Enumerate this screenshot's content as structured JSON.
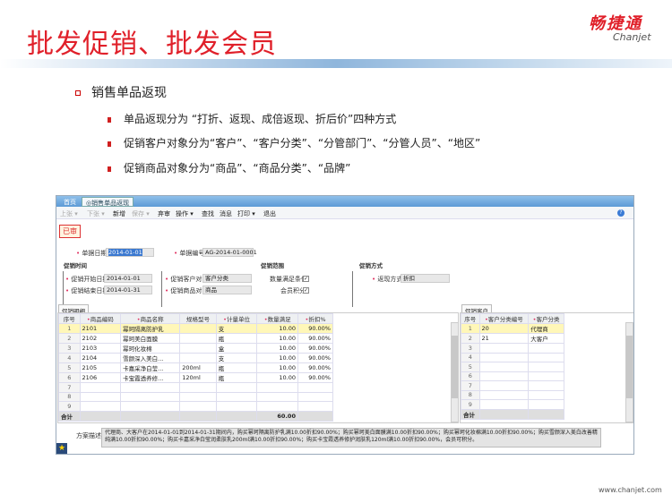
{
  "slide": {
    "title": "批发促销、批发会员",
    "logo_cn": "畅捷通",
    "logo_en": "Chanjet",
    "bullet": "销售单品返现",
    "sub_bullets": [
      "单品返现分为 “打折、返现、成倍返现、折后价”四种方式",
      "促销客户对象分为“客户”、“客户分类”、“分管部门”、“分管人员”、“地区”",
      "促销商品对象分为“商品”、“商品分类”、“品牌”"
    ],
    "footer": "www.chanjet.com",
    "accent_color": "#e0202a"
  },
  "app": {
    "tabs": [
      {
        "label": "首页"
      },
      {
        "label": "销售单品返现",
        "active": true
      }
    ],
    "toolbar": [
      {
        "label": "上张 ▾",
        "disabled": true
      },
      {
        "label": "下张 ▾",
        "disabled": true
      },
      {
        "label": "新增"
      },
      {
        "label": "保存 ▾",
        "disabled": true
      },
      {
        "label": "弃审"
      },
      {
        "label": "操作 ▾"
      },
      {
        "label": "查找"
      },
      {
        "label": "消息"
      },
      {
        "label": "打印 ▾"
      },
      {
        "label": "退出"
      }
    ],
    "help_icon": "?",
    "status": "已审",
    "header": {
      "doc_date_label": "单据日期",
      "doc_date": "2014-01-01",
      "doc_no_label": "单据编号",
      "doc_no": "AG-2014-01-0001"
    },
    "sections": {
      "time": "促销时间",
      "scope": "促销范围",
      "method": "促销方式"
    },
    "fields": {
      "start_label": "促销开始日期",
      "start": "2014-01-01",
      "end_label": "促销结束日期",
      "end": "2014-01-31",
      "cust_obj_label": "促销客户对象",
      "cust_obj": "客户分类",
      "goods_obj_label": "促销商品对象",
      "goods_obj": "商品",
      "qty_cond_label": "数量满足条件",
      "qty_cond": true,
      "points_label": "会员积分",
      "points": true,
      "rebate_label": "返现方式",
      "rebate": "折扣"
    },
    "detail": {
      "tab": "促销明细",
      "columns": [
        "序号",
        "商品编码",
        "商品名称",
        "规格型号",
        "计量单位",
        "数量满足",
        "折扣%"
      ],
      "rows": [
        [
          "1",
          "2101",
          "幂珂隔离防护乳",
          "",
          "支",
          "10.00",
          "90.00%"
        ],
        [
          "2",
          "2102",
          "幂珂美白面膜",
          "",
          "瓶",
          "10.00",
          "90.00%"
        ],
        [
          "3",
          "2103",
          "幂珂化妆棉",
          "",
          "盒",
          "10.00",
          "90.00%"
        ],
        [
          "4",
          "2104",
          "雪颜深入美白...",
          "",
          "支",
          "10.00",
          "90.00%"
        ],
        [
          "5",
          "2105",
          "卡嘉采净白莹...",
          "200ml",
          "瓶",
          "10.00",
          "90.00%"
        ],
        [
          "6",
          "2106",
          "卡宝霞透养修...",
          "120ml",
          "瓶",
          "10.00",
          "90.00%"
        ],
        [
          "7",
          "",
          "",
          "",
          "",
          "",
          ""
        ],
        [
          "8",
          "",
          "",
          "",
          "",
          "",
          ""
        ],
        [
          "9",
          "",
          "",
          "",
          "",
          "",
          ""
        ]
      ],
      "total_label": "合计",
      "total_qty": "60.00"
    },
    "customers": {
      "tab": "促销客户",
      "columns": [
        "序号",
        "客户分类编号",
        "客户分类"
      ],
      "rows": [
        [
          "1",
          "20",
          "代理商"
        ],
        [
          "2",
          "21",
          "大客户"
        ],
        [
          "3",
          "",
          ""
        ],
        [
          "4",
          "",
          ""
        ],
        [
          "5",
          "",
          ""
        ],
        [
          "6",
          "",
          ""
        ],
        [
          "7",
          "",
          ""
        ],
        [
          "8",
          "",
          ""
        ],
        [
          "9",
          "",
          ""
        ]
      ],
      "total_label": "合计"
    },
    "description_label": "方案描述",
    "description": "代理商、大客户在2014-01-01到2014-01-31期间内，购买幂珂隔离防护乳满10.00折扣90.00%；购买幂珂美白面膜满10.00折扣90.00%；购买幂珂化妆棉满10.00折扣90.00%；购买雪颜深入美白改善精纯满10.00折扣90.00%；购买卡嘉采净白莹润柔肤乳200ml满10.00折扣90.00%；购买卡宝霞透养修护润肤乳120ml满10.00折扣90.00%，会员可积分。"
  }
}
